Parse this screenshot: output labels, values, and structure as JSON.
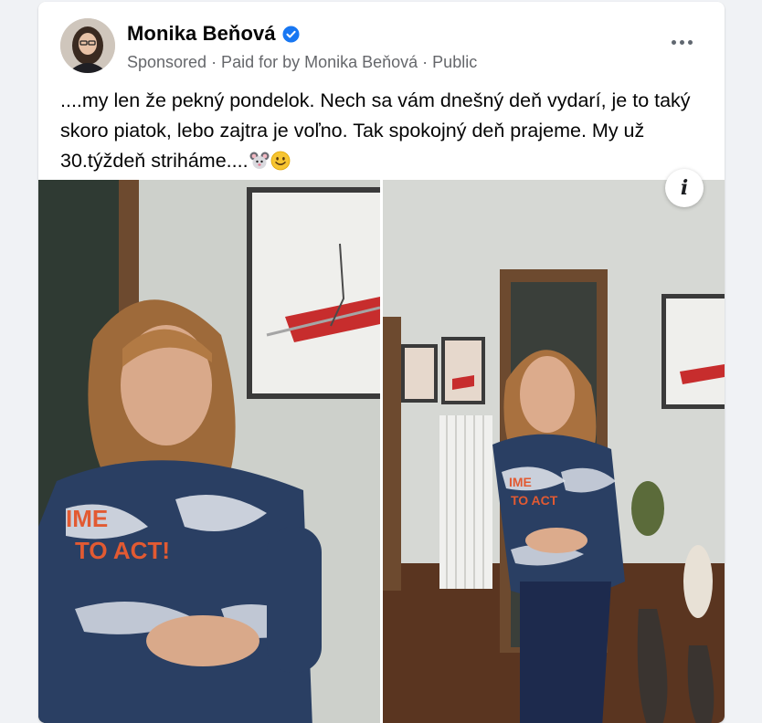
{
  "post": {
    "author": "Monika Beňová",
    "verified": true,
    "meta": "Sponsored · Paid for by Monika Beňová · Public",
    "text": "....my len že pekný pondelok. Nech sa vám dnešný deň vydarí, je to taký skoro piatok, lebo zajtra je voľno. Tak spokojný deň prajeme. My už 30.týždeň strihámе....",
    "emojis": [
      "mouse-face-emoji",
      "smiling-face-emoji"
    ]
  },
  "icons": {
    "verified": "verified-badge-icon",
    "more": "more-options-icon",
    "info": "info-icon"
  },
  "colors": {
    "verified_blue": "#1877f2",
    "secondary_text": "#65676b",
    "background": "#f0f2f5"
  }
}
